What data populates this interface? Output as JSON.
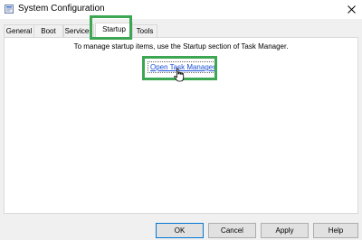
{
  "window": {
    "title": "System Configuration"
  },
  "tabs": [
    {
      "label": "General"
    },
    {
      "label": "Boot"
    },
    {
      "label": "Services"
    },
    {
      "label": "Startup",
      "active": true
    },
    {
      "label": "Tools"
    }
  ],
  "startup": {
    "info_text": "To manage startup items, use the Startup section of Task Manager.",
    "link_label": "Open Task Manager"
  },
  "buttons": {
    "ok": "OK",
    "cancel": "Cancel",
    "apply": "Apply",
    "help": "Help"
  },
  "colors": {
    "highlight": "#3ca652",
    "link": "#1a4fd6",
    "window_bg": "#f0f0f0"
  },
  "icons": {
    "app": "msconfig-icon",
    "close": "close-icon",
    "cursor": "hand-pointer-icon"
  }
}
